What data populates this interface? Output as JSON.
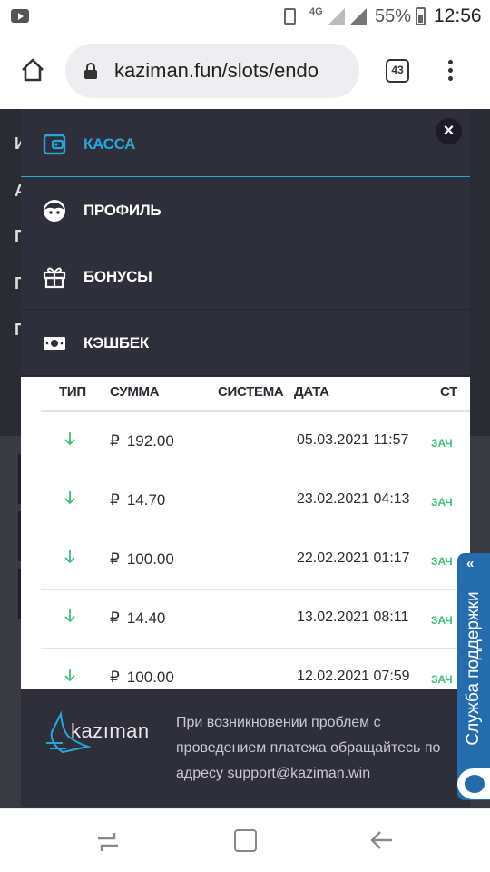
{
  "status_bar": {
    "network": "4G",
    "battery": "55%",
    "time": "12:56"
  },
  "browser": {
    "url": "kaziman.fun/slots/endo",
    "tab_count": "43"
  },
  "background": {
    "letters": [
      "И",
      "А",
      "П",
      "П",
      "П"
    ]
  },
  "menu": {
    "items": [
      {
        "label": "КАССА",
        "icon": "wallet-icon",
        "active": true
      },
      {
        "label": "ПРОФИЛЬ",
        "icon": "profile-face-icon",
        "active": false
      },
      {
        "label": "БОНУСЫ",
        "icon": "gift-icon",
        "active": false
      },
      {
        "label": "КЭШБЕК",
        "icon": "banknote-icon",
        "active": false
      }
    ]
  },
  "table": {
    "headers": {
      "type": "ТИП",
      "amount": "СУММА",
      "system": "СИСТЕМА",
      "date": "ДАТА",
      "status": "СТ"
    },
    "currency": "₽",
    "rows": [
      {
        "amount": "192.00",
        "date": "05.03.2021 11:57",
        "status": "ЗАЧ"
      },
      {
        "amount": "14.70",
        "date": "23.02.2021 04:13",
        "status": "ЗАЧ"
      },
      {
        "amount": "100.00",
        "date": "22.02.2021 01:17",
        "status": "ЗАЧ"
      },
      {
        "amount": "14.40",
        "date": "13.02.2021 08:11",
        "status": "ЗАЧ"
      },
      {
        "amount": "100.00",
        "date": "12.02.2021 07:59",
        "status": "ЗАЧ"
      }
    ]
  },
  "footer": {
    "logo_text": "kazıman",
    "text": "При возникновении проблем с проведением платежа обращайтесь по адресу support@kaziman.win"
  },
  "support": {
    "label": "Служба поддержки",
    "chevron": "«"
  },
  "colors": {
    "accent": "#27a7d8",
    "status_green": "#3dbf74",
    "modal_bg": "#2f2e3b",
    "support_blue": "#246cab"
  }
}
